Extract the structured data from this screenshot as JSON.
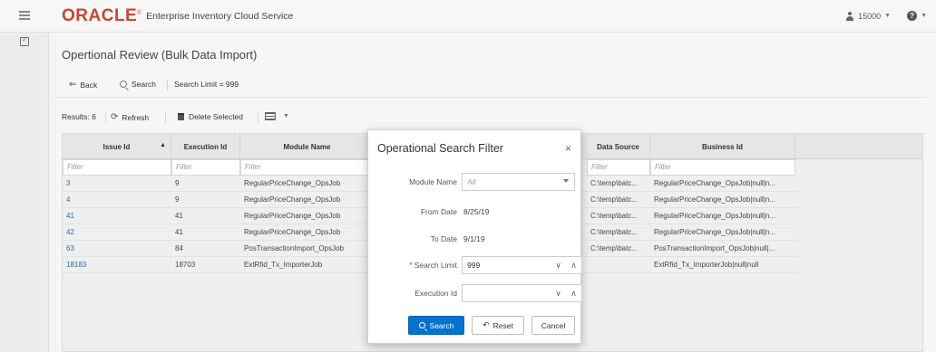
{
  "app": {
    "logo": "ORACLE",
    "logo_mark": "®",
    "title": "Enterprise Inventory Cloud Service",
    "store": "15000"
  },
  "page": {
    "title": "Opertional Review (Bulk Data Import)"
  },
  "toolbar": {
    "back_label": "Back",
    "search_label": "Search",
    "search_limit": "Search Limit = 999"
  },
  "results_bar": {
    "results_label": "Results: 6",
    "refresh_label": "Refresh",
    "delete_label": "Delete Selected"
  },
  "table": {
    "columns": [
      "Issue Id",
      "Execution Id",
      "Module Name",
      "Data Source",
      "Business Id"
    ],
    "filter_placeholder": "Filter",
    "rows": [
      {
        "issue_id": "3",
        "execution_id": "9",
        "module_name": "RegularPriceChange_OpsJob",
        "data_source": "C:\\temp\\batc...",
        "business_id": "RegularPriceChange_OpsJob|null|n..."
      },
      {
        "issue_id": "4",
        "execution_id": "9",
        "module_name": "RegularPriceChange_OpsJob",
        "data_source": "C:\\temp\\batc...",
        "business_id": "RegularPriceChange_OpsJob|null|n..."
      },
      {
        "issue_id": "41",
        "execution_id": "41",
        "module_name": "RegularPriceChange_OpsJob",
        "data_source": "C:\\temp\\batc...",
        "business_id": "RegularPriceChange_OpsJob|null|n..."
      },
      {
        "issue_id": "42",
        "execution_id": "41",
        "module_name": "RegularPriceChange_OpsJob",
        "data_source": "C:\\temp\\batc...",
        "business_id": "RegularPriceChange_OpsJob|null|n..."
      },
      {
        "issue_id": "63",
        "execution_id": "84",
        "module_name": "PosTransactionImport_OpsJob",
        "data_source": "C:\\temp\\batc...",
        "business_id": "PosTransactionImport_OpsJob|null|..."
      },
      {
        "issue_id": "18183",
        "execution_id": "18703",
        "module_name": "ExtRfid_Tx_ImporterJob",
        "data_source": "",
        "business_id": "ExtRfid_Tx_ImporterJob|null|null"
      }
    ]
  },
  "dialog": {
    "title": "Operational Search Filter",
    "close_glyph": "×",
    "module_name_label": "Module Name",
    "module_name_value": "All",
    "from_date_label": "From Date",
    "from_date_value": "8/25/19",
    "to_date_label": "To Date",
    "to_date_value": "9/1/19",
    "required_mark": "*",
    "search_limit_label": "Search Limit",
    "search_limit_value": "999",
    "execution_id_label": "Execution Id",
    "execution_id_value": "",
    "stepper_down": "∨",
    "stepper_up": "∧",
    "search_button": "Search",
    "reset_button": "Reset",
    "cancel_button": "Cancel"
  },
  "colors": {
    "brand": "#c74634",
    "primary_button": "#0572ce",
    "link": "#2a6ba8"
  }
}
